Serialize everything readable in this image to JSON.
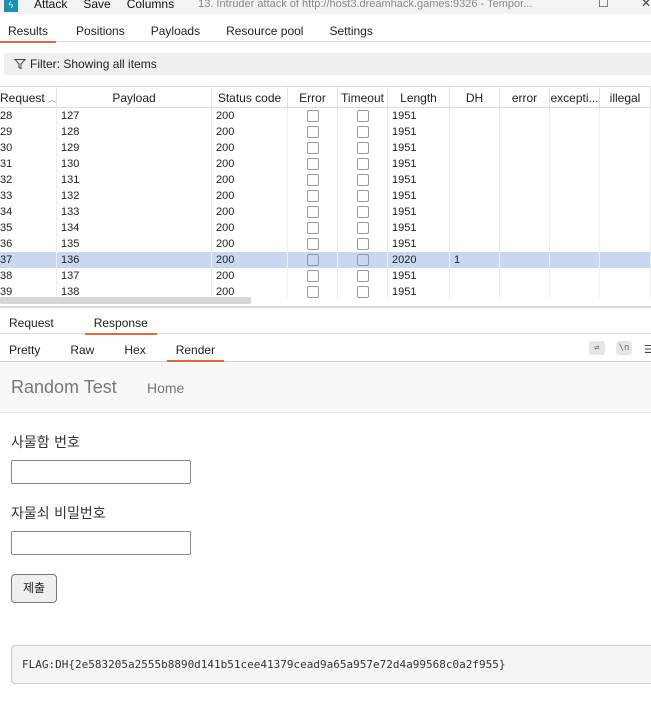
{
  "titlebar": {
    "menu": [
      "Attack",
      "Save",
      "Columns"
    ],
    "window_title": "13. Intruder attack of http://host3.dreamhack.games:9326 - Tempor..."
  },
  "main_tabs": [
    "Results",
    "Positions",
    "Payloads",
    "Resource pool",
    "Settings"
  ],
  "filter": {
    "label": "Filter: Showing all items"
  },
  "table": {
    "columns": [
      "Request",
      "Payload",
      "Status code",
      "Error",
      "Timeout",
      "Length",
      "DH",
      "error",
      "excepti...",
      "illegal"
    ],
    "rows": [
      {
        "req": "28",
        "payload": "127",
        "status": "200",
        "length": "1951",
        "dh": ""
      },
      {
        "req": "29",
        "payload": "128",
        "status": "200",
        "length": "1951",
        "dh": ""
      },
      {
        "req": "30",
        "payload": "129",
        "status": "200",
        "length": "1951",
        "dh": ""
      },
      {
        "req": "31",
        "payload": "130",
        "status": "200",
        "length": "1951",
        "dh": ""
      },
      {
        "req": "32",
        "payload": "131",
        "status": "200",
        "length": "1951",
        "dh": ""
      },
      {
        "req": "33",
        "payload": "132",
        "status": "200",
        "length": "1951",
        "dh": ""
      },
      {
        "req": "34",
        "payload": "133",
        "status": "200",
        "length": "1951",
        "dh": ""
      },
      {
        "req": "35",
        "payload": "134",
        "status": "200",
        "length": "1951",
        "dh": ""
      },
      {
        "req": "36",
        "payload": "135",
        "status": "200",
        "length": "1951",
        "dh": ""
      },
      {
        "req": "37",
        "payload": "136",
        "status": "200",
        "length": "2020",
        "dh": "1"
      },
      {
        "req": "38",
        "payload": "137",
        "status": "200",
        "length": "1951",
        "dh": ""
      },
      {
        "req": "39",
        "payload": "138",
        "status": "200",
        "length": "1951",
        "dh": ""
      }
    ],
    "selected_row": 9
  },
  "rr_tabs": [
    "Request",
    "Response"
  ],
  "view_tabs": [
    "Pretty",
    "Raw",
    "Hex",
    "Render"
  ],
  "toolbar_icons": {
    "wrap": "⇌",
    "newline": "\\n",
    "menu": "☰"
  },
  "render": {
    "brand": "Random Test",
    "nav_home": "Home",
    "label_box_number": "사물함 번호",
    "label_password": "자물쇠 비밀번호",
    "submit": "제출",
    "flag": "FLAG:DH{2e583205a2555b8890d141b51cee41379cead9a65a957e72d4a99568c0a2f955}"
  },
  "colors": {
    "accent": "#e8673a",
    "selected_row": "#c9d8f0"
  }
}
